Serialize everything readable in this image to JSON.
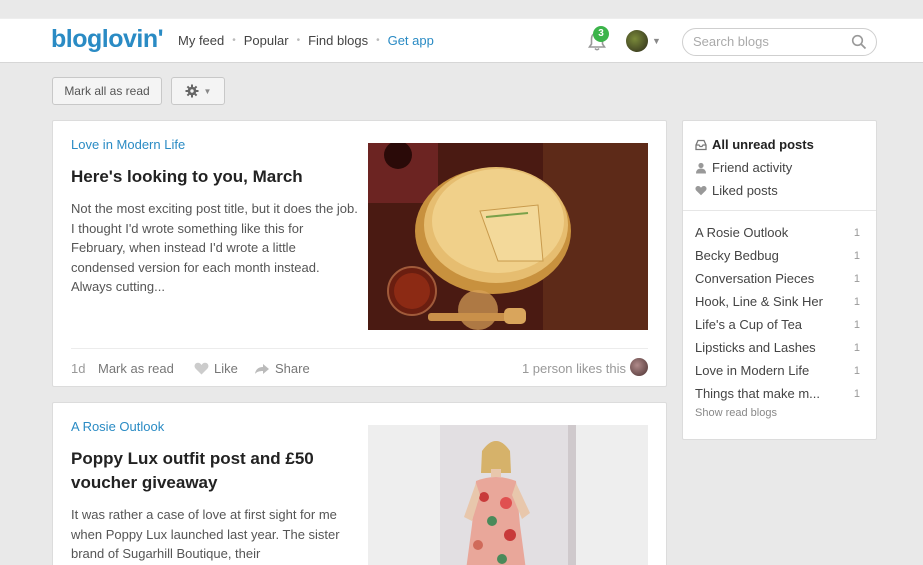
{
  "header": {
    "logo": "bloglovin'",
    "nav": [
      "My feed",
      "Popular",
      "Find blogs",
      "Get app"
    ],
    "notification_count": "3",
    "search_placeholder": "Search blogs"
  },
  "toolbar": {
    "mark_all_label": "Mark all as read",
    "settings_icon": "gear-icon"
  },
  "posts": [
    {
      "blog": "Love in Modern Life",
      "title": "Here's looking to you, March",
      "excerpt": "Not the most exciting post title, but it does the job. I thought I'd wrote something like this for February, when instead I'd wrote a little condensed version for each month instead. Always cutting...",
      "age": "1d",
      "mark_label": "Mark as read",
      "like_label": "Like",
      "share_label": "Share",
      "likes_text": "1 person likes this"
    },
    {
      "blog": "A Rosie Outlook",
      "title": "Poppy Lux outfit post and £50 voucher giveaway",
      "excerpt": "It was rather a case of love at first sight for me when Poppy Lux launched last year.  The sister brand of Sugarhill Boutique, their"
    }
  ],
  "sidebar": {
    "filters": [
      {
        "label": "All unread posts",
        "icon": "inbox-icon"
      },
      {
        "label": "Friend activity",
        "icon": "person-icon"
      },
      {
        "label": "Liked posts",
        "icon": "heart-icon"
      }
    ],
    "blogs": [
      {
        "name": "A Rosie Outlook",
        "count": "1"
      },
      {
        "name": "Becky Bedbug",
        "count": "1"
      },
      {
        "name": "Conversation Pieces",
        "count": "1"
      },
      {
        "name": "Hook, Line & Sink Her",
        "count": "1"
      },
      {
        "name": "Life's a Cup of Tea",
        "count": "1"
      },
      {
        "name": "Lipsticks and Lashes",
        "count": "1"
      },
      {
        "name": "Love in Modern Life",
        "count": "1"
      },
      {
        "name": "Things that make m...",
        "count": "1"
      }
    ],
    "show_read": "Show read blogs"
  },
  "colors": {
    "accent": "#2a8bc4",
    "badge": "#3cb44a",
    "background": "#e9e9e9"
  }
}
